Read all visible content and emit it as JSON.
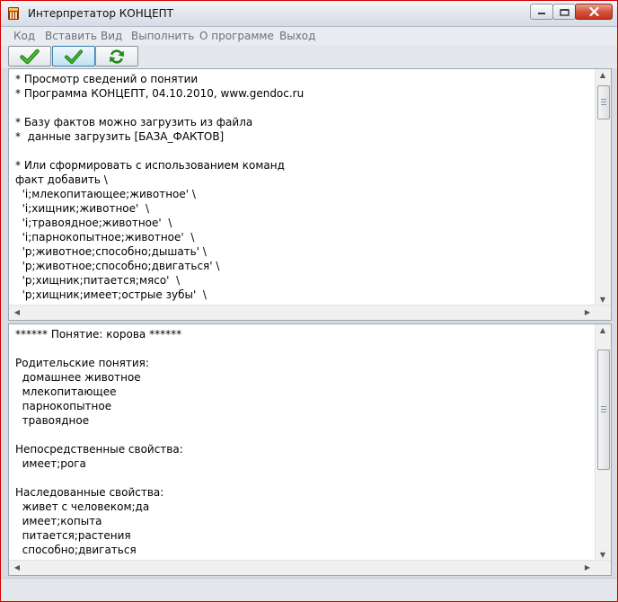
{
  "window": {
    "title": "Интерпретатор КОНЦЕПТ"
  },
  "menu": [
    "Код",
    "Вставить",
    "Вид",
    "Выполнить",
    "О программе",
    "Выход"
  ],
  "toolbar": {
    "buttons": [
      {
        "icon": "green-check-icon"
      },
      {
        "icon": "green-check-icon",
        "state": "hovered"
      },
      {
        "icon": "green-refresh-icon"
      }
    ]
  },
  "editor": {
    "lines": [
      "* Просмотр сведений о понятии",
      "* Программа КОНЦЕПТ, 04.10.2010, www.gendoc.ru",
      "",
      "* Базу фактов можно загрузить из файла",
      "*  данные загрузить [БАЗА_ФАКТОВ]",
      "",
      "* Или сформировать с использованием команд",
      "факт добавить \\",
      "  'i;млекопитающее;животное' \\",
      "  'i;хищник;животное'  \\",
      "  'i;травоядное;животное'  \\",
      "  'i;парнокопытное;животное'  \\",
      "  'p;животное;способно;дышать' \\",
      "  'p;животное;способно;двигаться' \\",
      "  'p;хищник;питается;мясо'  \\",
      "  'p;хищник;имеет;острые зубы'  \\"
    ]
  },
  "output": {
    "lines": [
      "****** Понятие: корова ******",
      "",
      "Родительские понятия:",
      "  домашнее животное",
      "  млекопитающее",
      "  парнокопытное",
      "  травоядное",
      "",
      "Непосредственные свойства:",
      "  имеет;рога",
      "",
      "Наследованные свойства:",
      "  живет с человеком;да",
      "  имеет;копыта",
      "  питается;растения",
      "  способно;двигаться"
    ]
  },
  "colors": {
    "check_green": "#2a9a1c",
    "title_bar": "#e3e8ef",
    "close_red": "#c6331a",
    "window_border": "#d40000"
  }
}
